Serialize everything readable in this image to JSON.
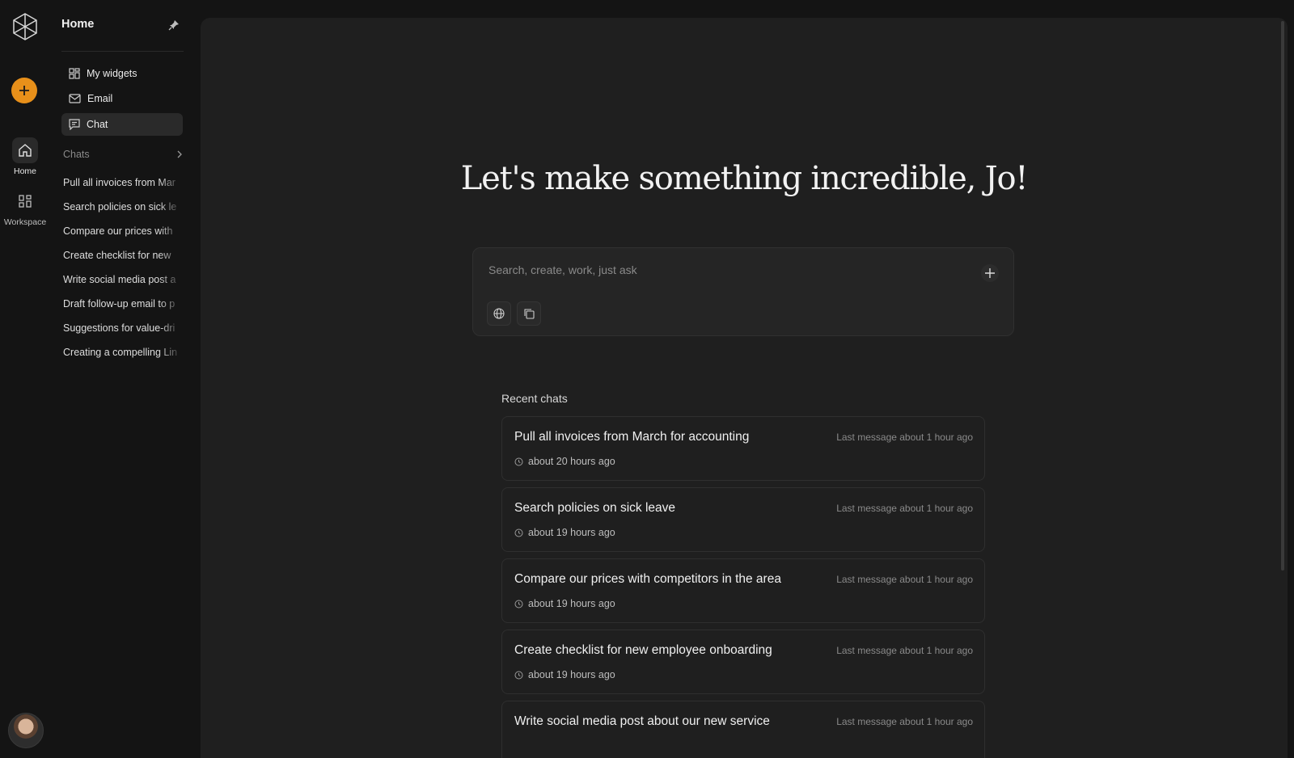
{
  "rail": {
    "items": [
      {
        "label": "Home",
        "icon": "home-icon"
      },
      {
        "label": "Workspace",
        "icon": "grid-icon"
      }
    ],
    "accent_color": "#e8901a"
  },
  "sidebar": {
    "title": "Home",
    "nav": [
      {
        "label": "My widgets",
        "icon": "widgets-icon"
      },
      {
        "label": "Email",
        "icon": "mail-icon"
      },
      {
        "label": "Chat",
        "icon": "chat-icon"
      }
    ],
    "chats_header": "Chats",
    "chats": [
      "Pull all invoices from Mar",
      "Search policies on sick le",
      "Compare our prices with",
      "Create checklist for new",
      "Write social media post a",
      "Draft follow-up email to p",
      "Suggestions for value-dri",
      "Creating a compelling Lin"
    ]
  },
  "main": {
    "headline": "Let's make something incredible, Jo!",
    "search": {
      "placeholder": "Search, create, work, just ask"
    },
    "recent_label": "Recent chats",
    "recent": [
      {
        "title": "Pull all invoices from March for accounting",
        "meta": "Last message about 1 hour ago",
        "time": "about 20 hours ago"
      },
      {
        "title": "Search policies on sick leave",
        "meta": "Last message about 1 hour ago",
        "time": "about 19 hours ago"
      },
      {
        "title": "Compare our prices with competitors in the area",
        "meta": "Last message about 1 hour ago",
        "time": "about 19 hours ago"
      },
      {
        "title": "Create checklist for new employee onboarding",
        "meta": "Last message about 1 hour ago",
        "time": "about 19 hours ago"
      },
      {
        "title": "Write social media post about our new service",
        "meta": "Last message about 1 hour ago",
        "time": ""
      }
    ]
  }
}
